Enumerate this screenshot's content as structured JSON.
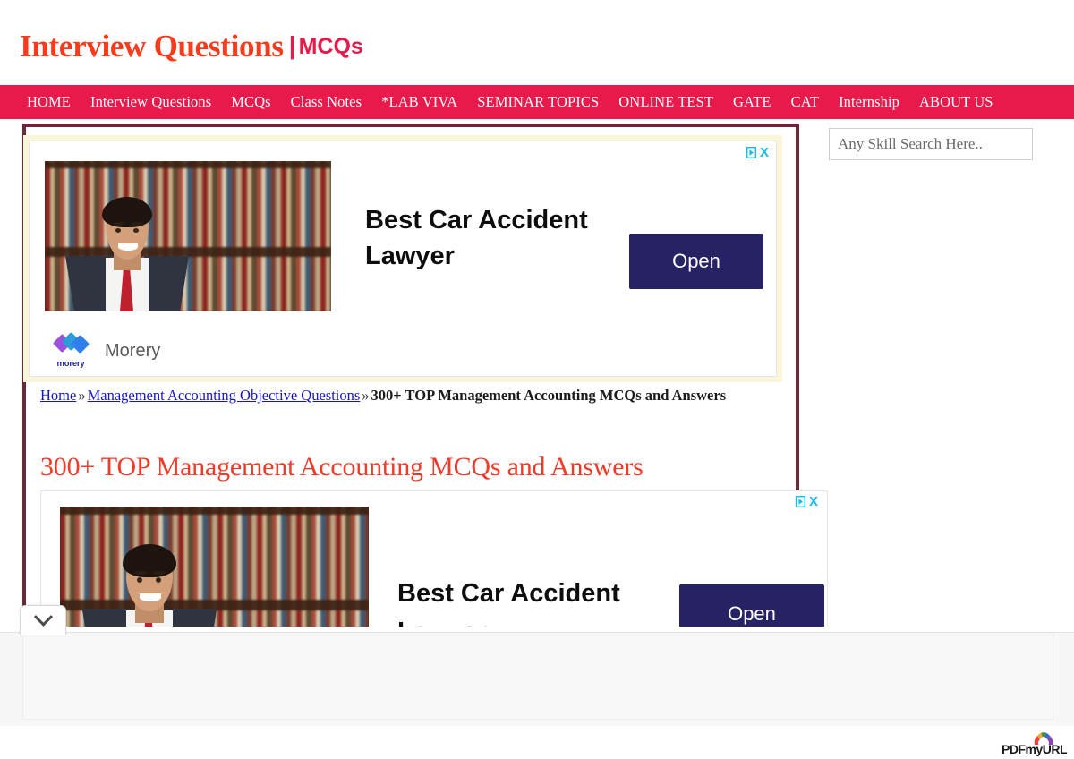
{
  "site": {
    "brand_main": "Interview Questions",
    "brand_pipe": "|",
    "brand_sub": "MCQs",
    "brand_color": "#F93B1D",
    "nav_bg_color": "#E8194B",
    "frame_border_color": "#6B2737"
  },
  "nav": {
    "items": [
      {
        "label": "HOME"
      },
      {
        "label": "Interview Questions"
      },
      {
        "label": "MCQs"
      },
      {
        "label": "Class Notes"
      },
      {
        "label": "*LAB VIVA"
      },
      {
        "label": "SEMINAR TOPICS"
      },
      {
        "label": "ONLINE TEST"
      },
      {
        "label": "GATE"
      },
      {
        "label": "CAT"
      },
      {
        "label": "Internship"
      },
      {
        "label": "ABOUT US"
      }
    ]
  },
  "search": {
    "placeholder": "Any Skill Search Here..",
    "value": ""
  },
  "breadcrumb": {
    "home": "Home",
    "sep1": "»",
    "category": "Management Accounting Objective Questions",
    "sep2": "»",
    "current": "300+ TOP Management Accounting MCQs and Answers",
    "link_color": "#1414CC"
  },
  "post": {
    "title": "300+ TOP Management Accounting MCQs and Answers",
    "title_color": "#F23A28"
  },
  "ads": [
    {
      "id": "ad-top",
      "headline_line1": "Best Car Accident",
      "headline_line2": "Lawyer",
      "cta_label": "Open",
      "cta_color": "#272264",
      "advertiser_name": "Morery",
      "advertiser_logo_text": "morery",
      "adchoices_label": "AdChoices",
      "close_label": "X"
    },
    {
      "id": "ad-bottom",
      "headline_line1": "Best Car Accident",
      "headline_line2": "Lawyer",
      "cta_label": "Open",
      "cta_color": "#272264",
      "adchoices_label": "AdChoices",
      "close_label": "X"
    }
  ],
  "controls": {
    "collapse_label": "Collapse ad"
  },
  "watermark": {
    "text": "PDFmyURL"
  }
}
